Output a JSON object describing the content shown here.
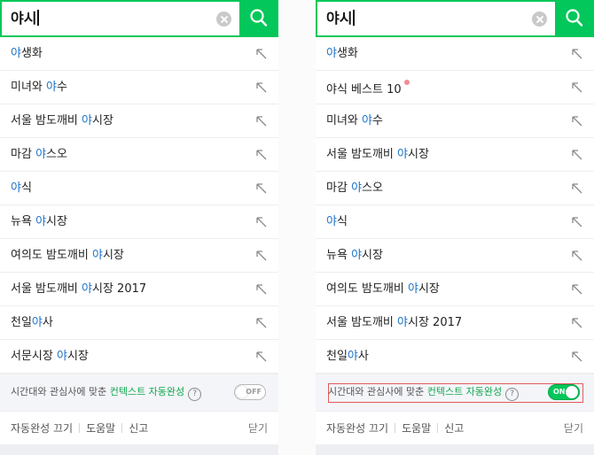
{
  "left": {
    "query": "야시",
    "suggestions": [
      {
        "hl": "야",
        "rest": "생화"
      },
      {
        "pre": "미녀와 ",
        "hl": "야",
        "rest": "수"
      },
      {
        "pre": "서울 밤도깨비 ",
        "hl": "야",
        "rest": "시장"
      },
      {
        "pre": "마감 ",
        "hl": "야",
        "rest": "스오"
      },
      {
        "hl": "야",
        "rest": "식"
      },
      {
        "pre": "뉴욕 ",
        "hl": "야",
        "rest": "시장"
      },
      {
        "pre": "여의도 밤도깨비 ",
        "hl": "야",
        "rest": "시장"
      },
      {
        "pre": "서울 밤도깨비 ",
        "hl": "야",
        "rest": "시장 2017"
      },
      {
        "pre": "천일",
        "hl": "야",
        "rest": "사"
      },
      {
        "pre": "서문시장 ",
        "hl": "야",
        "rest": "시장"
      }
    ],
    "context": {
      "text": "시간대와 관심사에 맞춘 ",
      "accent": "컨텍스트 자동완성",
      "help": "?",
      "toggle": "OFF"
    }
  },
  "right": {
    "query": "야시",
    "suggestions": [
      {
        "hl": "야",
        "rest": "생화"
      },
      {
        "pre": "야식 베스트 10",
        "new_dot": true
      },
      {
        "pre": "미녀와 ",
        "hl": "야",
        "rest": "수"
      },
      {
        "pre": "서울 밤도깨비 ",
        "hl": "야",
        "rest": "시장"
      },
      {
        "pre": "마감 ",
        "hl": "야",
        "rest": "스오"
      },
      {
        "hl": "야",
        "rest": "식"
      },
      {
        "pre": "뉴욕 ",
        "hl": "야",
        "rest": "시장"
      },
      {
        "pre": "여의도 밤도깨비 ",
        "hl": "야",
        "rest": "시장"
      },
      {
        "pre": "서울 밤도깨비 ",
        "hl": "야",
        "rest": "시장 2017"
      },
      {
        "pre": "천일",
        "hl": "야",
        "rest": "사"
      }
    ],
    "context": {
      "text": "시간대와 관심사에 맞춘 ",
      "accent": "컨텍스트 자동완성",
      "help": "?",
      "toggle": "ON"
    }
  },
  "footer": {
    "links": [
      "자동완성 끄기",
      "도움말",
      "신고"
    ],
    "close": "닫기"
  },
  "colors": {
    "brand": "#03c75a",
    "highlight": "#1d73c9",
    "accent": "#0fa84c",
    "frame": "#e25b5b"
  }
}
